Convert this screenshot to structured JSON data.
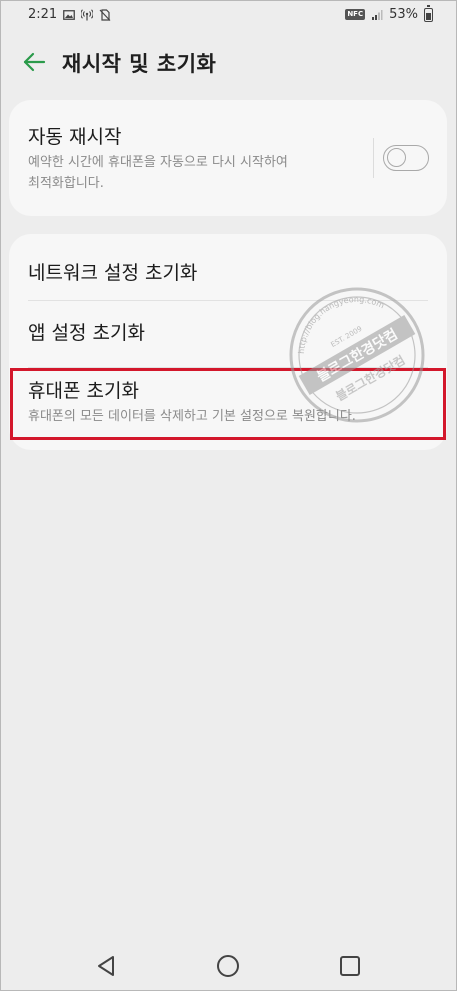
{
  "status_bar": {
    "time": "2:21",
    "battery": "53%",
    "nfc_label": "NFC",
    "left_icons": [
      "image-icon",
      "hotspot-icon",
      "no-sim-icon"
    ],
    "right_icons": [
      "nfc-icon",
      "signal-icon",
      "battery-icon"
    ]
  },
  "header": {
    "title": "재시작 및 초기화",
    "back_icon": "arrow-left-icon"
  },
  "auto_restart": {
    "title": "자동 재시작",
    "summary_line1": "예약한 시간에 휴대폰을 자동으로 다시 시작하여",
    "summary_line2": "최적화합니다.",
    "toggle_state": "off"
  },
  "reset_items": [
    {
      "title": "네트워크 설정 초기화"
    },
    {
      "title": "앱 설정 초기화"
    },
    {
      "title": "휴대폰 초기화",
      "summary": "휴대폰의 모든 데이터를 삭제하고 기본 설정으로 복원합니다."
    }
  ],
  "watermark": {
    "top_text": "http://blog.hangyeong.com",
    "middle_text": "블로그한경닷컴",
    "est_text": "EST. 2009"
  },
  "nav_bar": {
    "icons": [
      "back-triangle-icon",
      "home-circle-icon",
      "recent-square-icon"
    ]
  },
  "colors": {
    "accent_green": "#2a9a4a",
    "highlight_red": "#d3172b",
    "background": "#ededed",
    "card": "#f7f7f7"
  }
}
